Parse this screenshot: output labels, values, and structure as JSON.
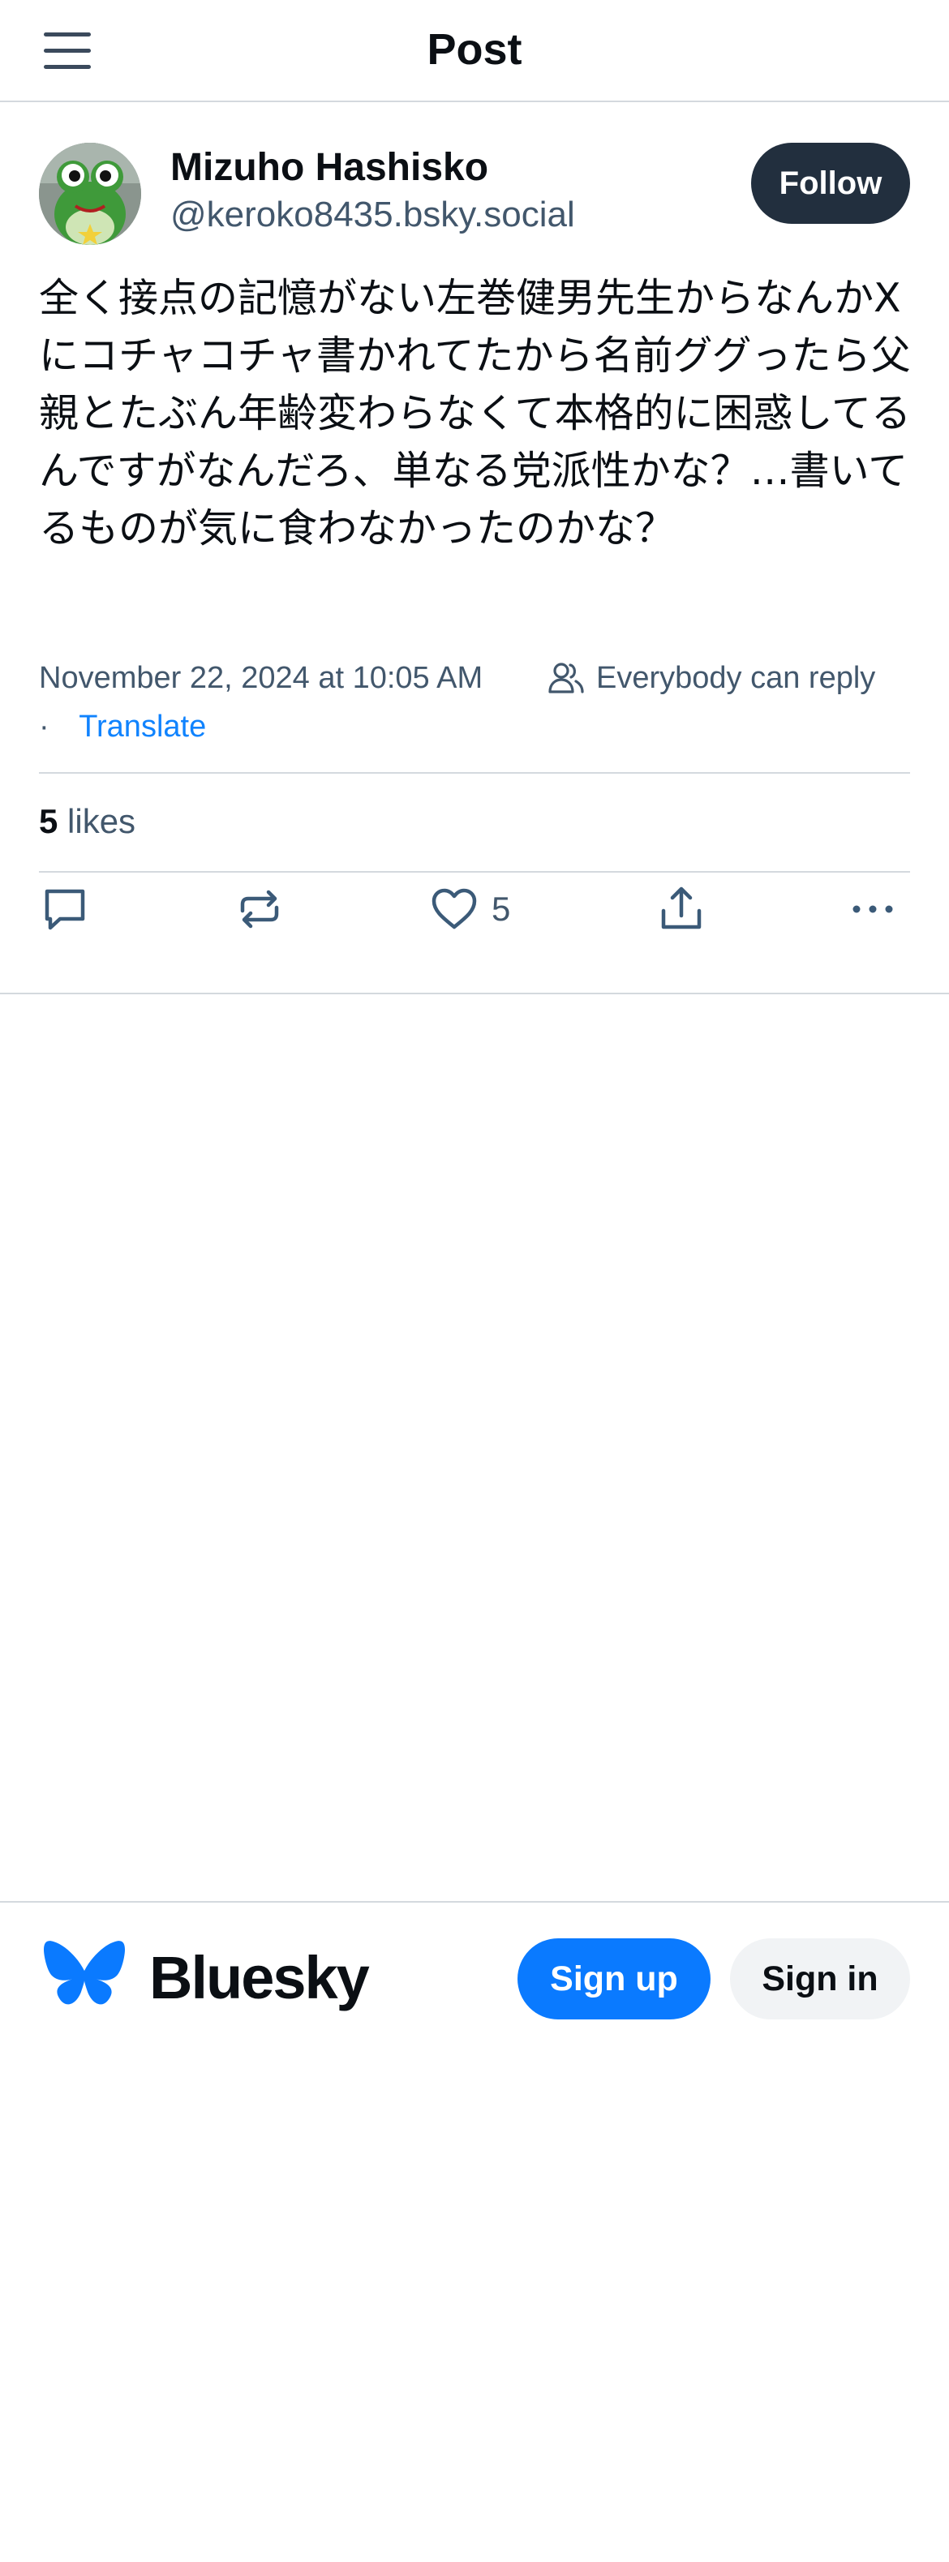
{
  "header": {
    "title": "Post",
    "menu_icon": "hamburger-menu-icon"
  },
  "post": {
    "author": {
      "display_name": "Mizuho Hashisko",
      "handle": "@keroko8435.bsky.social",
      "avatar_icon": "frog-character-avatar"
    },
    "follow_label": "Follow",
    "text": "全く接点の記憶がない左巻健男先生からなんかXにコチャコチャ書かれてたから名前ググったら父親とたぶん年齢変わらなくて本格的に困惑してるんですがなんだろ、単なる党派性かな？…書いてるものが気に食わなかったのかな？",
    "timestamp": "November 22, 2024 at 10:05 AM",
    "reply_setting": "Everybody can reply",
    "reply_setting_icon": "people-icon",
    "separator": "·",
    "translate_label": "Translate",
    "likes": {
      "count": "5",
      "label": "likes"
    },
    "actions": {
      "reply_icon": "comment-icon",
      "repost_icon": "repost-icon",
      "like_icon": "heart-icon",
      "like_count": "5",
      "share_icon": "share-icon",
      "more_icon": "more-dots-icon"
    }
  },
  "footer": {
    "brand_name": "Bluesky",
    "brand_icon": "butterfly-icon",
    "signup_label": "Sign up",
    "signin_label": "Sign in"
  },
  "colors": {
    "primary": "#0a7aff",
    "link": "#1083fe",
    "follow_button": "#222f3e",
    "muted_text": "#42576c",
    "border": "#d4d9de"
  }
}
